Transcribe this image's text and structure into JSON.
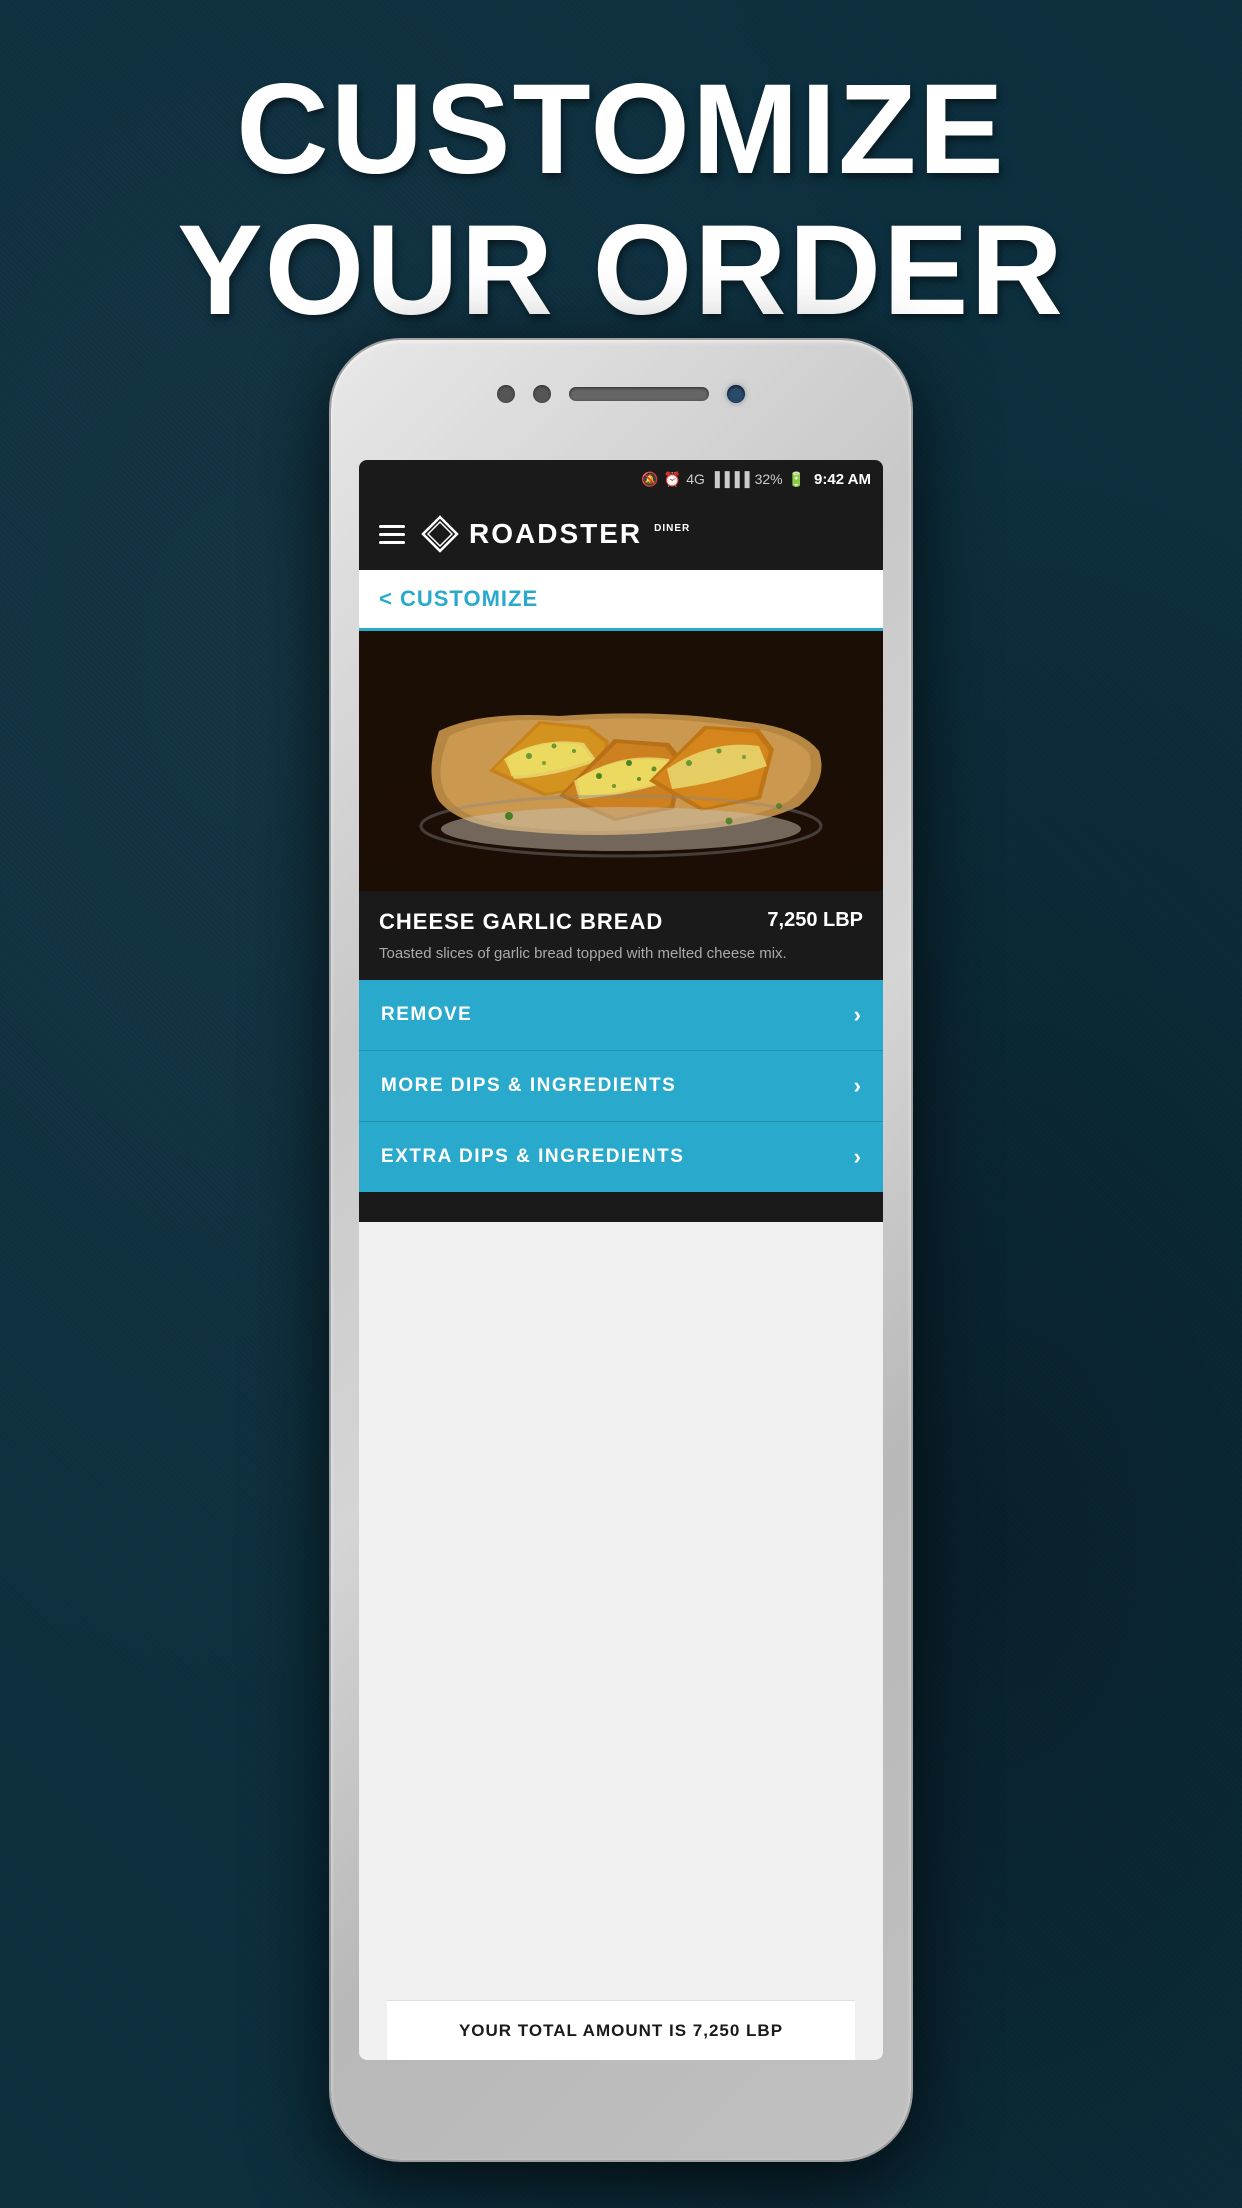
{
  "background": {
    "color": "#0d3040"
  },
  "headline": {
    "line1": "CUSTOMIZE",
    "line2": "YOUR ORDER"
  },
  "phone": {
    "status_bar": {
      "mute_icon": "🔕",
      "alarm_icon": "⏰",
      "signal": "4G",
      "battery_percent": "32%",
      "time": "9:42 AM"
    },
    "header": {
      "menu_icon": "hamburger",
      "brand_name": "ROADSTER",
      "brand_sub": "DINER"
    },
    "back_nav": {
      "label": "< CUSTOMIZE"
    },
    "item": {
      "name": "CHEESE GARLIC BREAD",
      "price": "7,250 LBP",
      "description": "Toasted slices of garlic bread topped with melted cheese mix."
    },
    "options": [
      {
        "label": "REMOVE",
        "has_chevron": true
      },
      {
        "label": "MORE DIPS & INGREDIENTS",
        "has_chevron": true
      },
      {
        "label": "EXTRA DIPS & INGREDIENTS",
        "has_chevron": true
      }
    ],
    "total_bar": {
      "text": "YOUR TOTAL AMOUNT IS 7,250 LBP"
    }
  }
}
